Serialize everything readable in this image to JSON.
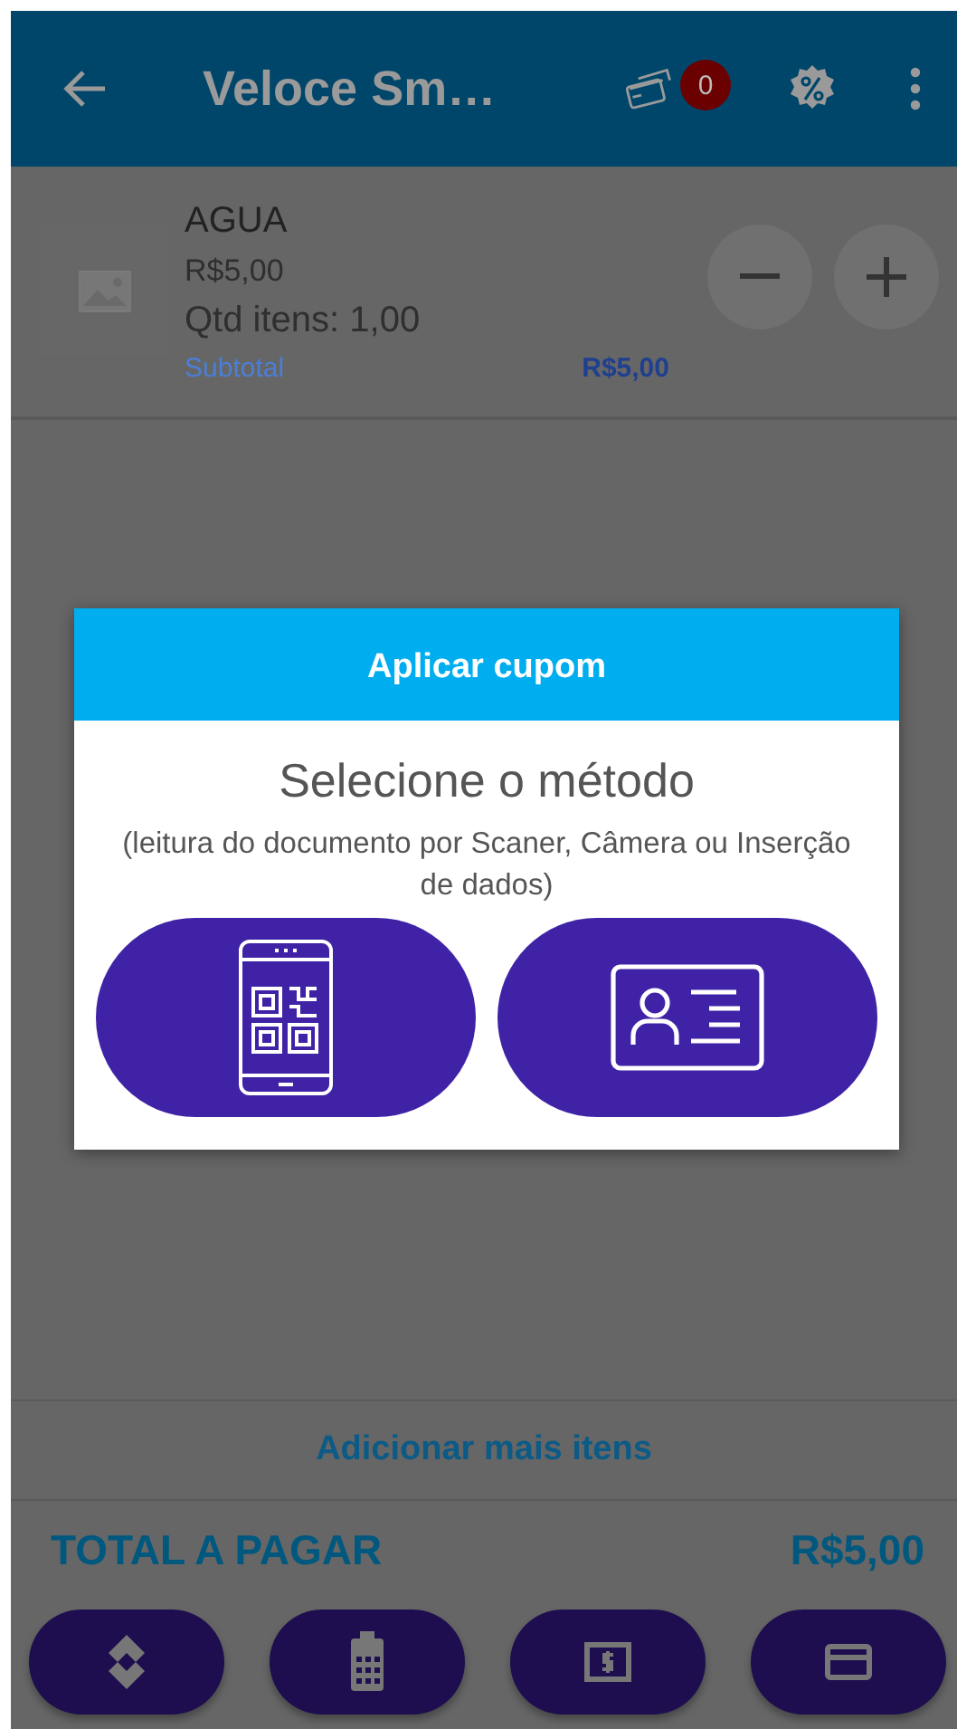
{
  "app_bar": {
    "title": "Veloce Sm…",
    "cart_badge": "0"
  },
  "cart_items": [
    {
      "name": "AGUA",
      "price": "R$5,00",
      "quantity": "Qtd itens: 1,00",
      "subtotal_label": "Subtotal",
      "subtotal": "R$5,00"
    }
  ],
  "add_more": "Adicionar mais itens",
  "total": {
    "label": "TOTAL A PAGAR",
    "value": "R$5,00"
  },
  "payment_buttons": [
    {
      "kind": "pix"
    },
    {
      "kind": "pos"
    },
    {
      "kind": "cash"
    },
    {
      "kind": "card"
    }
  ],
  "dialog": {
    "title": "Aplicar cupom",
    "heading": "Selecione o método",
    "description": "(leitura do documento por Scaner, Câmera ou Inserção de dados)",
    "options": [
      {
        "kind": "qr"
      },
      {
        "kind": "id_card"
      }
    ]
  }
}
